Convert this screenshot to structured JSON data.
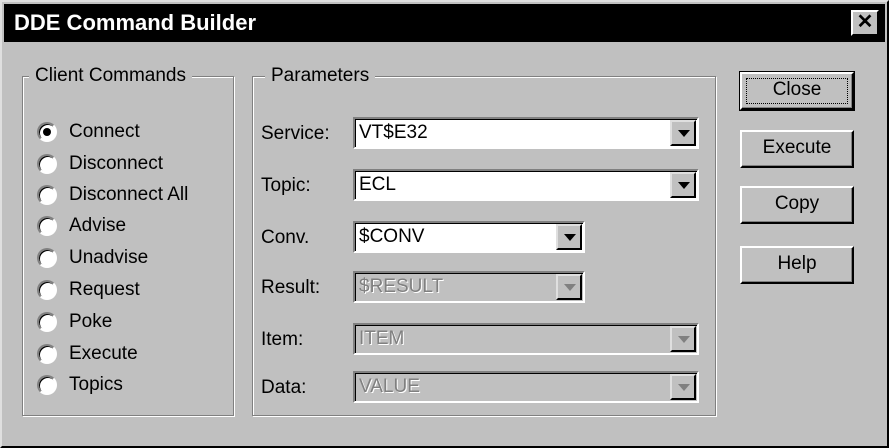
{
  "window": {
    "title": "DDE Command Builder",
    "close_glyph": "✕"
  },
  "client_commands": {
    "legend": "Client Commands",
    "selected": "Connect",
    "options": [
      {
        "label": "Connect",
        "checked": true
      },
      {
        "label": "Disconnect",
        "checked": false
      },
      {
        "label": "Disconnect All",
        "checked": false
      },
      {
        "label": "Advise",
        "checked": false
      },
      {
        "label": "Unadvise",
        "checked": false
      },
      {
        "label": "Request",
        "checked": false
      },
      {
        "label": "Poke",
        "checked": false
      },
      {
        "label": "Execute",
        "checked": false
      },
      {
        "label": "Topics",
        "checked": false
      }
    ]
  },
  "parameters": {
    "legend": "Parameters",
    "fields": [
      {
        "label": "Service:",
        "value": "VT$E32",
        "enabled": true
      },
      {
        "label": "Topic:",
        "value": "ECL",
        "enabled": true
      },
      {
        "label": "Conv.",
        "value": "$CONV",
        "enabled": true
      },
      {
        "label": "Result:",
        "value": "$RESULT",
        "enabled": false
      },
      {
        "label": "Item:",
        "value": "ITEM",
        "enabled": false
      },
      {
        "label": "Data:",
        "value": "VALUE",
        "enabled": false
      }
    ]
  },
  "buttons": {
    "close": "Close",
    "execute": "Execute",
    "copy": "Copy",
    "help": "Help"
  },
  "colors": {
    "face": "#c0c0c0",
    "titlebar": "#000000",
    "disabled_text": "#808080"
  }
}
